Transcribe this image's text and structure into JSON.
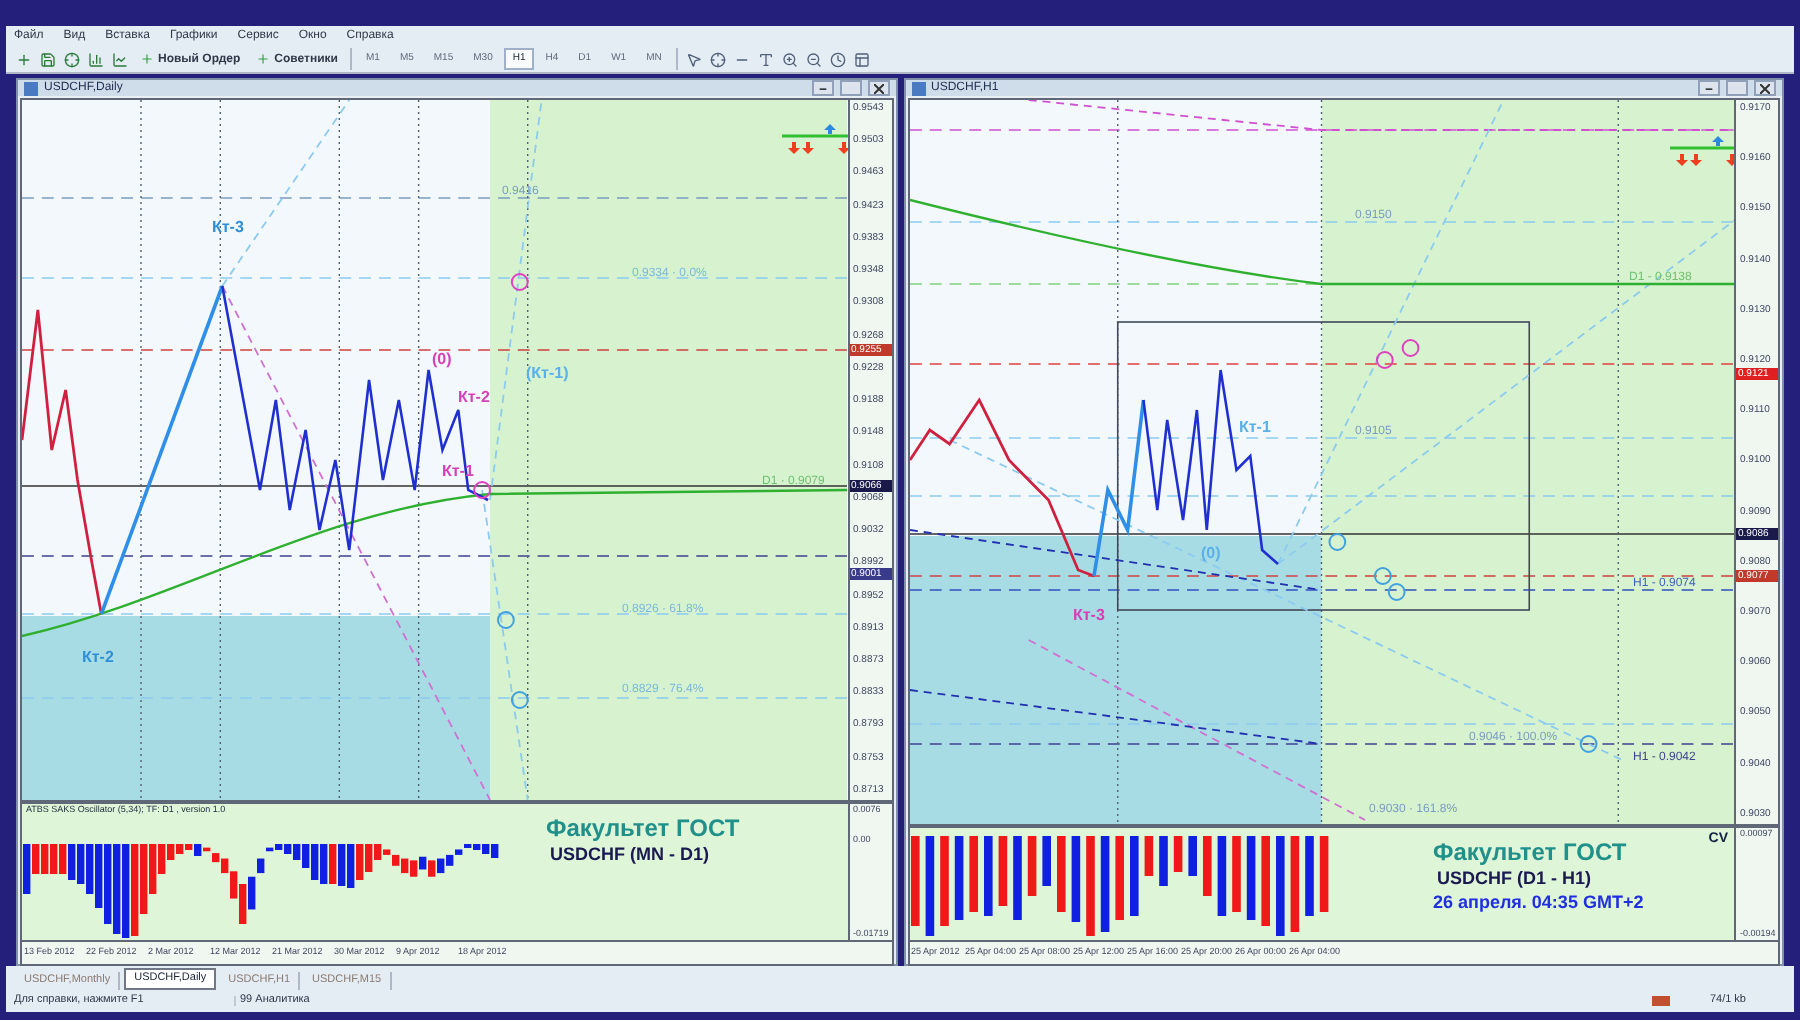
{
  "menu": [
    "Файл",
    "Вид",
    "Вставка",
    "Графики",
    "Сервис",
    "Окно",
    "Справка"
  ],
  "toolbar": {
    "buttons": [
      "Новый Ордер",
      "Советники"
    ],
    "timeframes": [
      {
        "label": "M1",
        "selected": false
      },
      {
        "label": "M5",
        "selected": false
      },
      {
        "label": "M15",
        "selected": false
      },
      {
        "label": "M30",
        "selected": false
      },
      {
        "label": "H1",
        "selected": true
      },
      {
        "label": "H4",
        "selected": false
      },
      {
        "label": "D1",
        "selected": false
      },
      {
        "label": "W1",
        "selected": false
      },
      {
        "label": "MN",
        "selected": false
      }
    ]
  },
  "windows": [
    {
      "kind": "daily",
      "title": "USDCHF,Daily",
      "price_axis": [
        "0.9543",
        "0.9503",
        "0.9463",
        "0.9423",
        "0.9383",
        "0.9348",
        "0.9308",
        "0.9268",
        "0.9228",
        "0.9188",
        "0.9148",
        "0.9108",
        "0.9068",
        "0.9032",
        "0.8992",
        "0.8952",
        "0.8913",
        "0.8873",
        "0.8833",
        "0.8793",
        "0.8753",
        "0.8713"
      ],
      "price_tags": [
        {
          "text": "0.9255",
          "color": "#c0392b"
        },
        {
          "text": "0.9066",
          "color": "#1a1a4a"
        },
        {
          "text": "0.9001",
          "color": "#3a3a8a"
        }
      ],
      "chart_labels": [
        {
          "text": "Кт-3",
          "color": "#2f8fd8"
        },
        {
          "text": "Кт-2",
          "color": "#2f8fd8"
        },
        {
          "text": "(0)",
          "color": "#d63fb8"
        },
        {
          "text": "Кт-2",
          "color": "#d63fb8"
        },
        {
          "text": "Кт-1",
          "color": "#d63fb8"
        },
        {
          "text": "(Кт-1)",
          "color": "#5ab0e8"
        }
      ],
      "level_labels": [
        "0.9416",
        "0.9334 · 0.0%",
        "D1 · 0.9079",
        "0.8926 · 61.8%",
        "0.8829 · 76.4%"
      ],
      "indicator": {
        "name": "ATBS SAKS Oscillator (5,34); TF: D1 , version 1.0",
        "axis": [
          "0.0076",
          "0.00",
          "-0.01719"
        ]
      },
      "caption": {
        "title": "Факультет ГОСТ",
        "subtitle": "USDCHF (MN - D1)"
      },
      "dates": [
        "13 Feb 2012",
        "22 Feb 2012",
        "2 Mar 2012",
        "12 Mar 2012",
        "21 Mar 2012",
        "30 Mar 2012",
        "9 Apr 2012",
        "18 Apr 2012"
      ]
    },
    {
      "kind": "hourly",
      "title": "USDCHF,H1",
      "price_axis": [
        "0.9170",
        "0.9160",
        "0.9150",
        "0.9140",
        "0.9130",
        "0.9120",
        "0.9110",
        "0.9100",
        "0.9090",
        "0.9080",
        "0.9070",
        "0.9060",
        "0.9050",
        "0.9040",
        "0.9030"
      ],
      "price_tags": [
        {
          "text": "0.9121",
          "color": "#e02020"
        },
        {
          "text": "0.9086",
          "color": "#1a1a4a"
        },
        {
          "text": "0.9077",
          "color": "#c0392b"
        }
      ],
      "chart_labels": [
        {
          "text": "Кт-3",
          "color": "#d63fb8"
        },
        {
          "text": "Кт-1",
          "color": "#5ab0e8"
        },
        {
          "text": "(0)",
          "color": "#5ab0e8"
        }
      ],
      "level_labels": [
        "0.9150",
        "D1 - 0.9138",
        "0.9105",
        "H1 - 0.9074",
        "0.9046 · 100.0%",
        "H1 - 0.9042",
        "0.9030 · 161.8%"
      ],
      "indicator": {
        "corner": "CV",
        "axis": [
          "0.00097",
          "-0.00194"
        ]
      },
      "caption": {
        "title": "Факультет ГОСТ",
        "subtitle": "USDCHF (D1 - H1)",
        "note": "26 апреля. 04:35 GMT+2"
      },
      "dates": [
        "25 Apr 2012",
        "25 Apr 04:00",
        "25 Apr 08:00",
        "25 Apr 12:00",
        "25 Apr 16:00",
        "25 Apr 20:00",
        "26 Apr 00:00",
        "26 Apr 04:00"
      ]
    }
  ],
  "tabs": [
    {
      "label": "USDCHF,Monthly",
      "selected": false
    },
    {
      "label": "USDCHF,Daily",
      "selected": true
    },
    {
      "label": "USDCHF,H1",
      "selected": false
    },
    {
      "label": "USDCHF,M15",
      "selected": false
    }
  ],
  "status_bar": {
    "help": "Для справки, нажмите F1",
    "profile": "99 Аналитика",
    "traffic": "74/1 kb"
  }
}
